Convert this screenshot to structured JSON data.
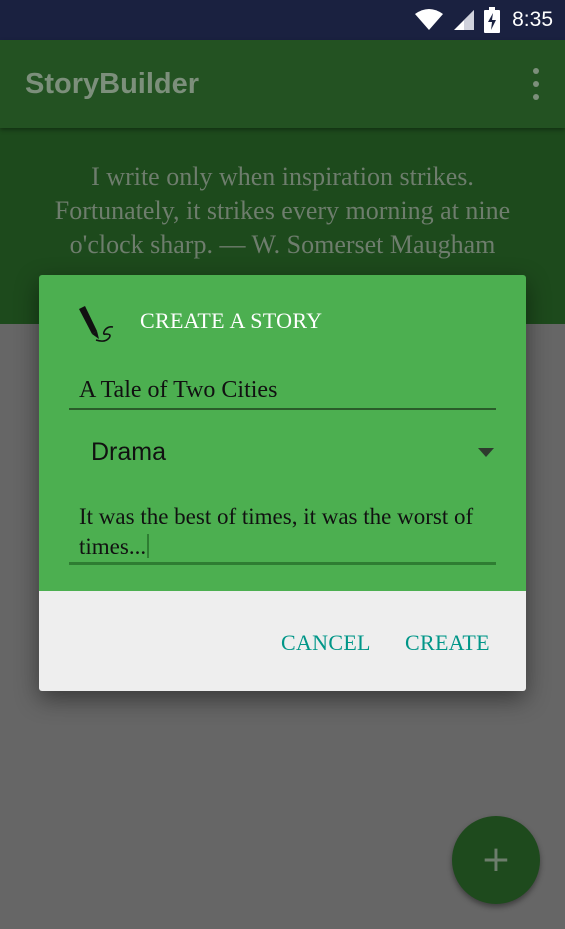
{
  "status_bar": {
    "time": "8:35",
    "icons": [
      "wifi-icon",
      "cell-signal-icon",
      "battery-charging-icon"
    ]
  },
  "app_bar": {
    "title": "StoryBuilder",
    "menu_icon": "overflow-menu-icon"
  },
  "quote": {
    "text": "I write only when inspiration strikes. Fortunately, it strikes every morning at nine o'clock sharp. — W. Somerset Maugham"
  },
  "dialog": {
    "icon": "fountain-pen-icon",
    "title": "CREATE A STORY",
    "story_title_value": "A Tale of Two Cities",
    "genre_selected": "Drama",
    "opening_line_value": "It was the best of times, it was the worst of times...",
    "cancel_label": "CANCEL",
    "create_label": "CREATE"
  },
  "fab": {
    "icon": "plus-icon",
    "label": "+"
  },
  "colors": {
    "status_bar": "#1a2140",
    "app_bar": "#235222",
    "dialog_header": "#4caf50",
    "dialog_actions": "#eeeeee",
    "button_text": "#009688",
    "fab": "#1e4a1d"
  }
}
